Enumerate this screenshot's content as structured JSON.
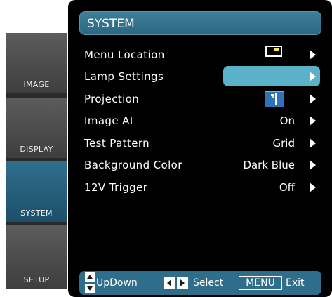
{
  "tabs": [
    {
      "label": "IMAGE",
      "active": false
    },
    {
      "label": "DISPLAY",
      "active": false
    },
    {
      "label": "SYSTEM",
      "active": true
    },
    {
      "label": "SETUP",
      "active": false
    }
  ],
  "header": {
    "title": "SYSTEM"
  },
  "menu": {
    "items": [
      {
        "label": "Menu Location",
        "value": "",
        "icon": "menu-location-icon"
      },
      {
        "label": "Lamp Settings",
        "value": "",
        "highlighted": true
      },
      {
        "label": "Projection",
        "value": "",
        "icon": "projection-icon"
      },
      {
        "label": "Image AI",
        "value": "On"
      },
      {
        "label": "Test Pattern",
        "value": "Grid"
      },
      {
        "label": "Background Color",
        "value": "Dark Blue"
      },
      {
        "label": "12V Trigger",
        "value": "Off"
      }
    ]
  },
  "help": {
    "updown": "UpDown",
    "select": "Select",
    "menu_key": "MENU",
    "exit": "Exit"
  },
  "colors": {
    "panel_bg": "#000000",
    "title_bar": "#3f7f99",
    "active_tab": "#2f6f8c",
    "highlight": "#5ab1c8",
    "help_bar": "#2e6e8a"
  }
}
